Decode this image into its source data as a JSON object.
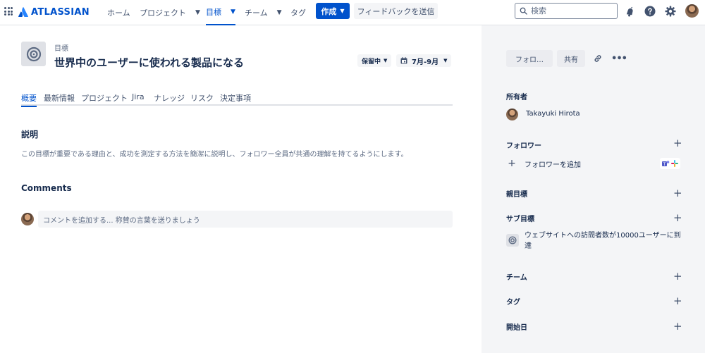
{
  "nav": {
    "brand": "ATLASSIAN",
    "items": [
      {
        "label": "ホーム"
      },
      {
        "label": "プロジェクト"
      },
      {
        "label": "目標"
      },
      {
        "label": "チーム"
      },
      {
        "label": "タグ"
      }
    ],
    "create_label": "作成",
    "feedback_label": "フィードバックを送信",
    "search_placeholder": "検索",
    "accent_color": "#0052CC"
  },
  "goal": {
    "breadcrumb": "目標",
    "title": "世界中のユーザーに使われる製品になる",
    "status": "保留中",
    "date_range": "7月-9月"
  },
  "tabs": [
    {
      "label": "概要"
    },
    {
      "label": "最新情報"
    },
    {
      "label": "プロジェクト"
    },
    {
      "label": "Jira"
    },
    {
      "label": "ナレッジ"
    },
    {
      "label": "リスク"
    },
    {
      "label": "決定事項"
    }
  ],
  "description": {
    "heading": "説明",
    "text": "この目標が重要である理由と、成功を測定する方法を簡潔に説明し、フォロワー全員が共通の理解を持てるようにします。"
  },
  "comments": {
    "heading": "Comments",
    "placeholder": "コメントを追加する... 称賛の言葉を送りましょう"
  },
  "sidebar": {
    "follow_label": "フォロ…",
    "share_label": "共有",
    "owner_heading": "所有者",
    "owner_name": "Takayuki Hirota",
    "followers_heading": "フォロワー",
    "add_follower_label": "フォロワーを追加",
    "parent_goal_heading": "親目標",
    "sub_goals_heading": "サブ目標",
    "sub_goal_text": "ウェブサイトへの訪問者数が10000ユーザーに到達",
    "team_heading": "チーム",
    "tags_heading": "タグ",
    "start_date_heading": "開始日"
  }
}
